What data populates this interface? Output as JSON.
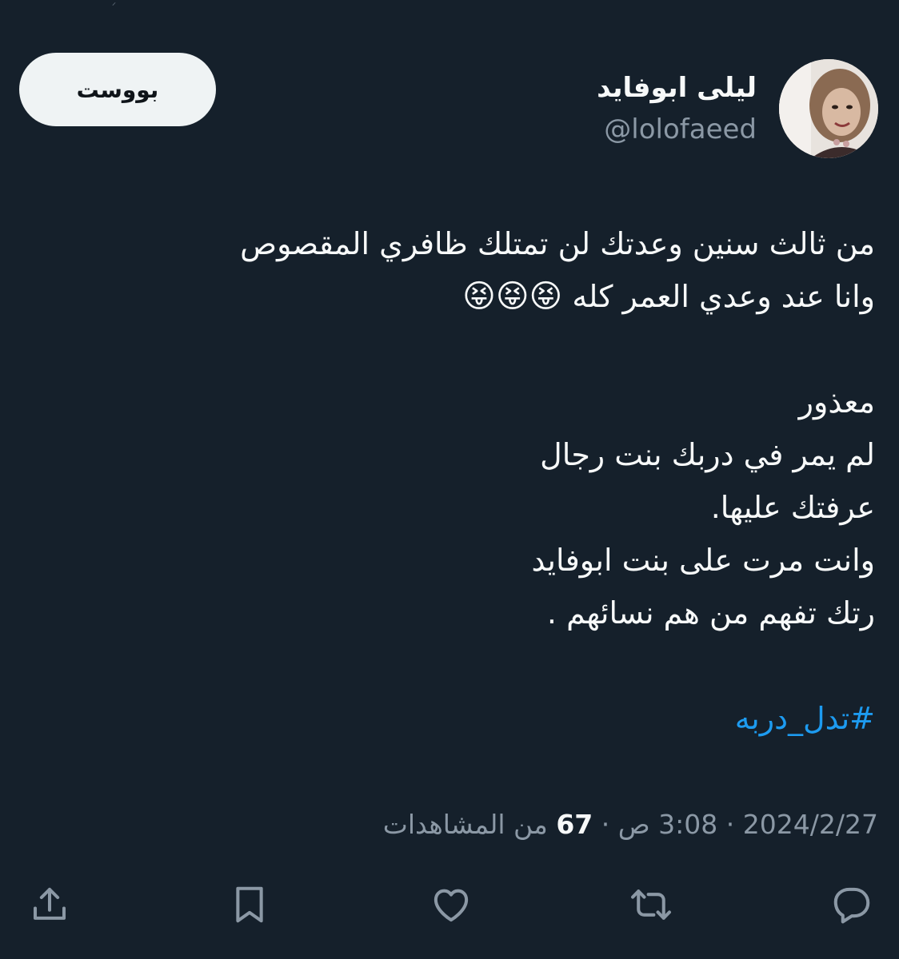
{
  "header": {
    "display_name": "ليلى ابوفايد",
    "handle": "@lolofaeed",
    "boost_label": "بووست"
  },
  "tweet": {
    "lines": [
      "من ثالث سنين وعدتك لن تمتلك ظافري المقصوص",
      "وانا عند وعدي العمر كله",
      "",
      "معذور",
      "لم يمر في دربك بنت رجال",
      "عرفتك عليها.",
      "وانت مرت على بنت ابوفايد",
      "رتك تفهم من هم نسائهم .",
      ""
    ],
    "emoji": "😝😝😝",
    "hashtag": "#تدل_دربه"
  },
  "meta": {
    "date": "2024/2/27",
    "time": "3:08 ص",
    "views_count": "67",
    "views_label": "من المشاهدات",
    "separator": "·"
  },
  "actions": {
    "icons": [
      "reply-icon",
      "repost-icon",
      "like-icon",
      "bookmark-icon",
      "share-icon"
    ],
    "color": "#8b98a5"
  },
  "colors": {
    "background": "#15202b",
    "text": "#f7f9f9",
    "secondary": "#8b98a5",
    "accent": "#1d9bf0",
    "button_bg": "#eff3f4"
  }
}
